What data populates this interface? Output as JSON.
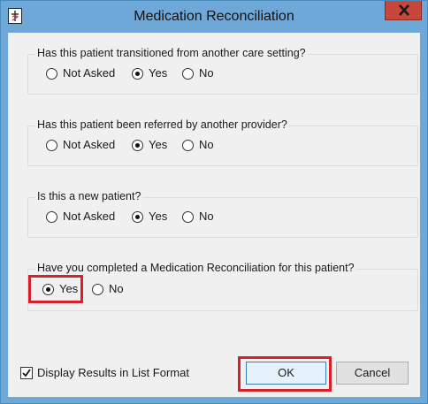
{
  "window": {
    "title": "Medication Reconciliation"
  },
  "groups": [
    {
      "question": "Has this patient transitioned from another care setting?",
      "options": [
        "Not Asked",
        "Yes",
        "No"
      ],
      "selected": "Yes"
    },
    {
      "question": "Has this patient been referred by another provider?",
      "options": [
        "Not Asked",
        "Yes",
        "No"
      ],
      "selected": "Yes"
    },
    {
      "question": "Is this a new patient?",
      "options": [
        "Not Asked",
        "Yes",
        "No"
      ],
      "selected": "Yes"
    },
    {
      "question": "Have you completed a Medication Reconciliation for this patient?",
      "options": [
        "Yes",
        "No"
      ],
      "selected": "Yes"
    }
  ],
  "footer": {
    "display_list_label": "Display Results in List Format",
    "display_list_checked": true,
    "ok_label": "OK",
    "cancel_label": "Cancel"
  },
  "colors": {
    "titlebar": "#6ea8d8",
    "close": "#c7473b",
    "highlight": "#d6202a"
  }
}
